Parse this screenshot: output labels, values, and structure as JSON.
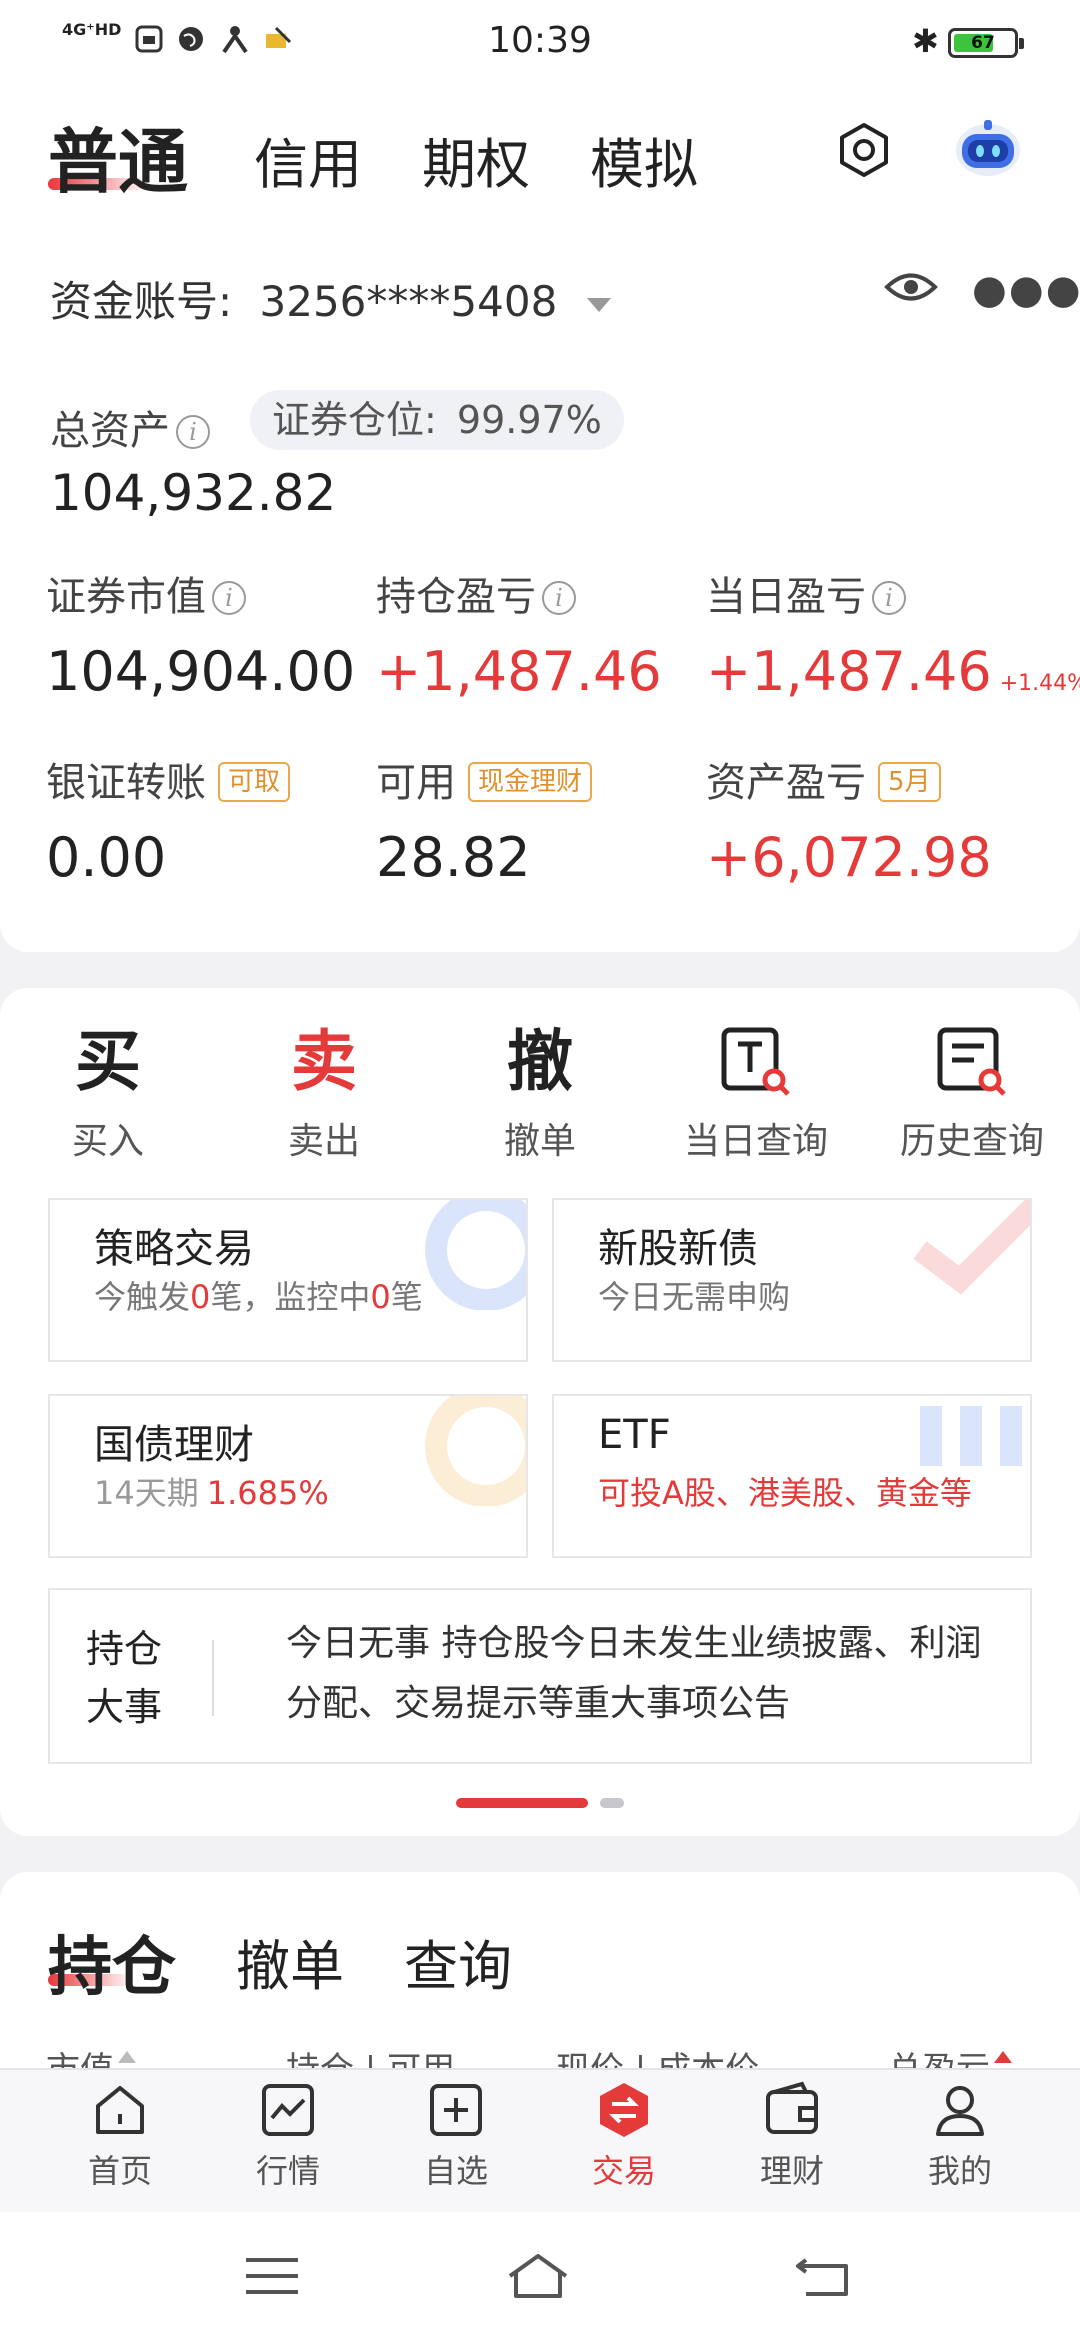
{
  "status_bar": {
    "network": "4G⁺HD",
    "time": "10:39",
    "battery": "67",
    "battery_level": 0.67,
    "icons": [
      "sim-icon",
      "globe-icon",
      "person-icon",
      "notification-icon",
      "bluetooth-icon"
    ]
  },
  "header": {
    "tabs": [
      "普通",
      "信用",
      "期权",
      "模拟"
    ],
    "active_tab": 0,
    "settings_icon": "gear-icon",
    "assistant_icon": "robot-icon"
  },
  "account": {
    "label": "资金账号:",
    "number": "3256****5408"
  },
  "assets": {
    "total_label": "总资产",
    "total_value": "104,932.82",
    "position_label": "证券仓位:",
    "position_value": "99.97%",
    "market_value_label": "证券市值",
    "market_value": "104,904.00",
    "holding_pl_label": "持仓盈亏",
    "holding_pl": "+1,487.46",
    "daily_pl_label": "当日盈亏",
    "daily_pl": "+1,487.46",
    "daily_pl_pct": "+1.44%",
    "transfer_label": "银证转账",
    "transfer_tag": "可取",
    "transfer_value": "0.00",
    "available_label": "可用",
    "available_tag": "现金理财",
    "available_value": "28.82",
    "asset_pl_label": "资产盈亏",
    "asset_pl_tag": "5月",
    "asset_pl_value": "+6,072.98"
  },
  "functions": [
    {
      "glyph": "买",
      "label": "买入"
    },
    {
      "glyph": "卖",
      "label": "卖出"
    },
    {
      "glyph": "撤",
      "label": "撤单"
    },
    {
      "glyph": "",
      "label": "当日查询"
    },
    {
      "glyph": "",
      "label": "历史查询"
    }
  ],
  "boxes": {
    "strategy": {
      "title": "策略交易",
      "sub_a": "今触发",
      "sub_b": "0",
      "sub_c": "笔，监控中",
      "sub_d": "0",
      "sub_e": "笔"
    },
    "ipo": {
      "title": "新股新债",
      "sub": "今日无需申购"
    },
    "bond": {
      "title": "国债理财",
      "sub_a": "14天期",
      "sub_b": "1.685%"
    },
    "etf": {
      "title": "ETF",
      "sub": "可投A股、港美股、黄金等"
    }
  },
  "news": {
    "title": "持仓大事",
    "text": "今日无事 持仓股今日未发生业绩披露、利润分配、交易提示等重大事项公告"
  },
  "holdings": {
    "tabs": [
      "持仓",
      "撤单",
      "查询"
    ],
    "columns": [
      "市值",
      "持仓 | 可用",
      "现价 | 成本价",
      "总盈亏"
    ]
  },
  "bottom_nav": [
    {
      "label": "首页",
      "icon": "home-icon"
    },
    {
      "label": "行情",
      "icon": "chart-icon"
    },
    {
      "label": "自选",
      "icon": "add-icon"
    },
    {
      "label": "交易",
      "icon": "trade-icon"
    },
    {
      "label": "理财",
      "icon": "wallet-icon"
    },
    {
      "label": "我的",
      "icon": "profile-icon"
    }
  ],
  "colors": {
    "accent": "#e43a3a",
    "tag": "#e0902e",
    "positive": "#e43a3a"
  }
}
